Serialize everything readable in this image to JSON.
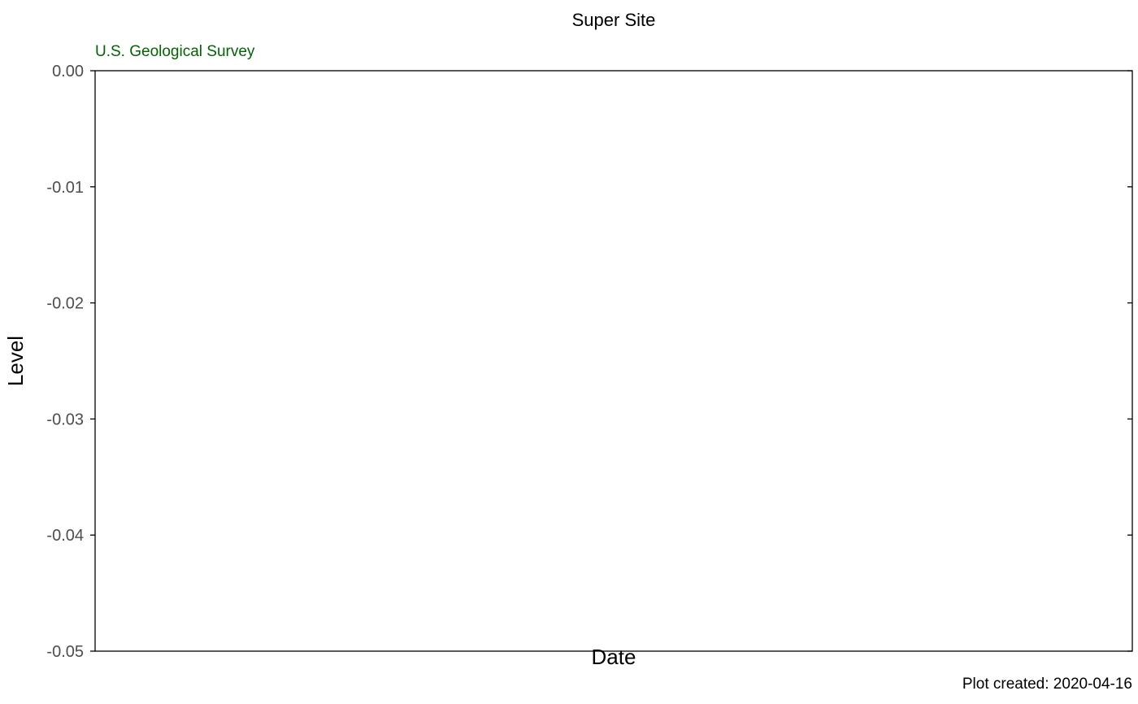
{
  "chart_data": {
    "type": "line",
    "title": "Super Site",
    "subtitle": "U.S. Geological Survey",
    "xlabel": "Date",
    "ylabel": "Level",
    "caption": "Plot created: 2020-04-16",
    "ylim": [
      -0.05,
      0.0
    ],
    "yticks": [
      0.0,
      -0.01,
      -0.02,
      -0.03,
      -0.04,
      -0.05
    ],
    "ytick_labels": [
      "0.00",
      "-0.01",
      "-0.02",
      "-0.03",
      "-0.04",
      "-0.05"
    ],
    "x": [],
    "series": [],
    "grid": false,
    "legend": "none"
  },
  "colors": {
    "subtitle": "#006400",
    "tick_label": "#4d4d4d",
    "axis": "#000000",
    "background": "#ffffff"
  }
}
